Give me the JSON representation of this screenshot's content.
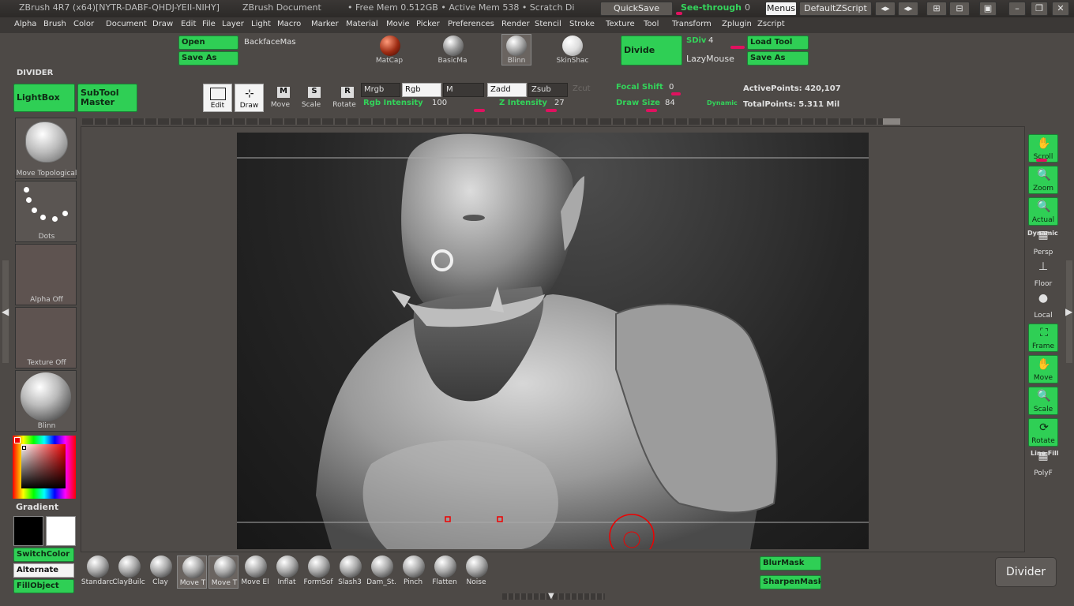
{
  "titlebar": {
    "app": "ZBrush 4R7 (x64)[NYTR-DABF-QHDJ-YEII-NIHY]",
    "doc": "ZBrush Document",
    "mem": "• Free Mem 0.512GB • Active Mem 538 • Scratch Di",
    "quicksave": "QuickSave",
    "seethrough": "See-through",
    "seethrough_val": "0",
    "menus": "Menus",
    "script": "DefaultZScript"
  },
  "menubar": [
    "Alpha",
    "Brush",
    "Color",
    "Document",
    "Draw",
    "Edit",
    "File",
    "Layer",
    "Light",
    "Macro",
    "Marker",
    "Material",
    "Movie",
    "Picker",
    "Preferences",
    "Render",
    "Stencil",
    "Stroke",
    "Texture",
    "Tool",
    "Transform",
    "Zplugin",
    "Zscript"
  ],
  "top": {
    "open": "Open",
    "backface": "BackfaceMas",
    "saveas": "Save As",
    "materials": [
      "MatCap",
      "BasicMa",
      "Blinn",
      "SkinShac"
    ],
    "divide": "Divide",
    "sdiv_label": "SDiv",
    "sdiv_val": "4",
    "lazymouse": "LazyMouse",
    "loadtool": "Load Tool",
    "saveas2": "Save As",
    "divider_title": "DIVIDER"
  },
  "shelf": {
    "lightbox": "LightBox",
    "subtool": "SubTool Master",
    "edit": "Edit",
    "draw": "Draw",
    "move": "Move",
    "scale": "Scale",
    "rotate": "Rotate",
    "mrgb": "Mrgb",
    "rgb": "Rgb",
    "m": "M",
    "zadd": "Zadd",
    "zsub": "Zsub",
    "zcut": "Zcut",
    "rgb_int_label": "Rgb Intensity",
    "rgb_int_val": "100",
    "z_int_label": "Z Intensity",
    "z_int_val": "27",
    "focal_label": "Focal Shift",
    "focal_val": "0",
    "drawsize_label": "Draw Size",
    "drawsize_val": "84",
    "dynamic": "Dynamic",
    "activepoints": "ActivePoints: 420,107",
    "totalpoints": "TotalPoints: 5.311 Mil"
  },
  "left": {
    "brush_name": "Move Topological",
    "stroke_name": "Dots",
    "alpha": "Alpha Off",
    "texture": "Texture Off",
    "material": "Blinn",
    "gradient": "Gradient",
    "switchcolor": "SwitchColor",
    "alternate": "Alternate",
    "fillobject": "FillObject",
    "accent_color": "#2fcf55"
  },
  "right": [
    "Scroll",
    "Zoom",
    "Actual",
    "Persp",
    "Floor",
    "Local",
    "Frame",
    "Move",
    "Scale",
    "Rotate",
    "PolyF"
  ],
  "right_extra": {
    "dynamic": "Dynamic",
    "linefill": "Line Fill"
  },
  "bottom": {
    "brushes": [
      "Standarc",
      "ClayBuilc",
      "Clay",
      "Move T",
      "Move T",
      "Move El",
      "Inflat",
      "FormSof",
      "Slash3",
      "Dam_St.",
      "Pinch",
      "Flatten",
      "Noise"
    ],
    "blurmask": "BlurMask",
    "sharpenmask": "SharpenMask",
    "tooltip": "Divider"
  }
}
